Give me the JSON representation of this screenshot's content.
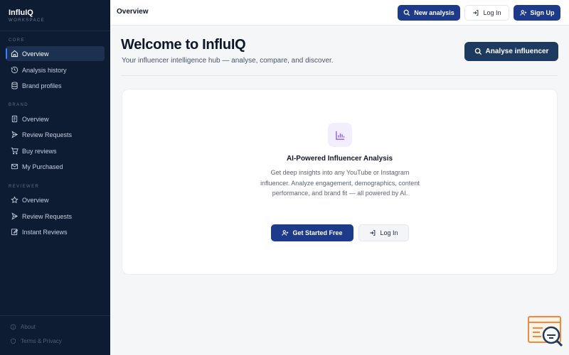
{
  "brand": {
    "name": "InfluIQ",
    "subtitle": "WORKSPACE"
  },
  "sidebar": {
    "sections": [
      {
        "label": "CORE",
        "items": [
          {
            "label": "Overview",
            "icon": "home-icon",
            "active": true
          },
          {
            "label": "Analysis history",
            "icon": "history-icon"
          },
          {
            "label": "Brand profiles",
            "icon": "database-icon"
          }
        ]
      },
      {
        "label": "BRAND",
        "items": [
          {
            "label": "Overview",
            "icon": "file-text-icon"
          },
          {
            "label": "Review Requests",
            "icon": "send-icon"
          },
          {
            "label": "Buy reviews",
            "icon": "cart-icon"
          },
          {
            "label": "My Purchased",
            "icon": "mail-icon"
          }
        ]
      },
      {
        "label": "REVIEWER",
        "items": [
          {
            "label": "Overview",
            "icon": "star-icon"
          },
          {
            "label": "Review Requests",
            "icon": "send-icon"
          },
          {
            "label": "Instant Reviews",
            "icon": "edit-icon"
          }
        ]
      }
    ],
    "footer": [
      {
        "label": "About",
        "icon": "info-icon"
      },
      {
        "label": "Terms & Privacy",
        "icon": "shield-icon"
      }
    ]
  },
  "topbar": {
    "title": "Overview",
    "new_analysis": "New analysis",
    "login": "Log In",
    "signup": "Sign Up"
  },
  "main": {
    "title": "Welcome to InfluIQ",
    "subtitle": "Your influencer intelligence hub — analyse, compare, and discover.",
    "analyse_button": "Analyse influencer"
  },
  "card": {
    "title": "AI-Powered Influencer Analysis",
    "description": "Get deep insights into any YouTube or Instagram influencer. Analyze engagement, demographics, content performance, and brand fit — all powered by AI.",
    "get_started": "Get Started Free",
    "login": "Log In"
  },
  "colors": {
    "sidebar_bg": "#0e1c33",
    "primary": "#1e3a8a",
    "accent": "#3b82f6",
    "feature_icon": "#8b5cf6"
  }
}
